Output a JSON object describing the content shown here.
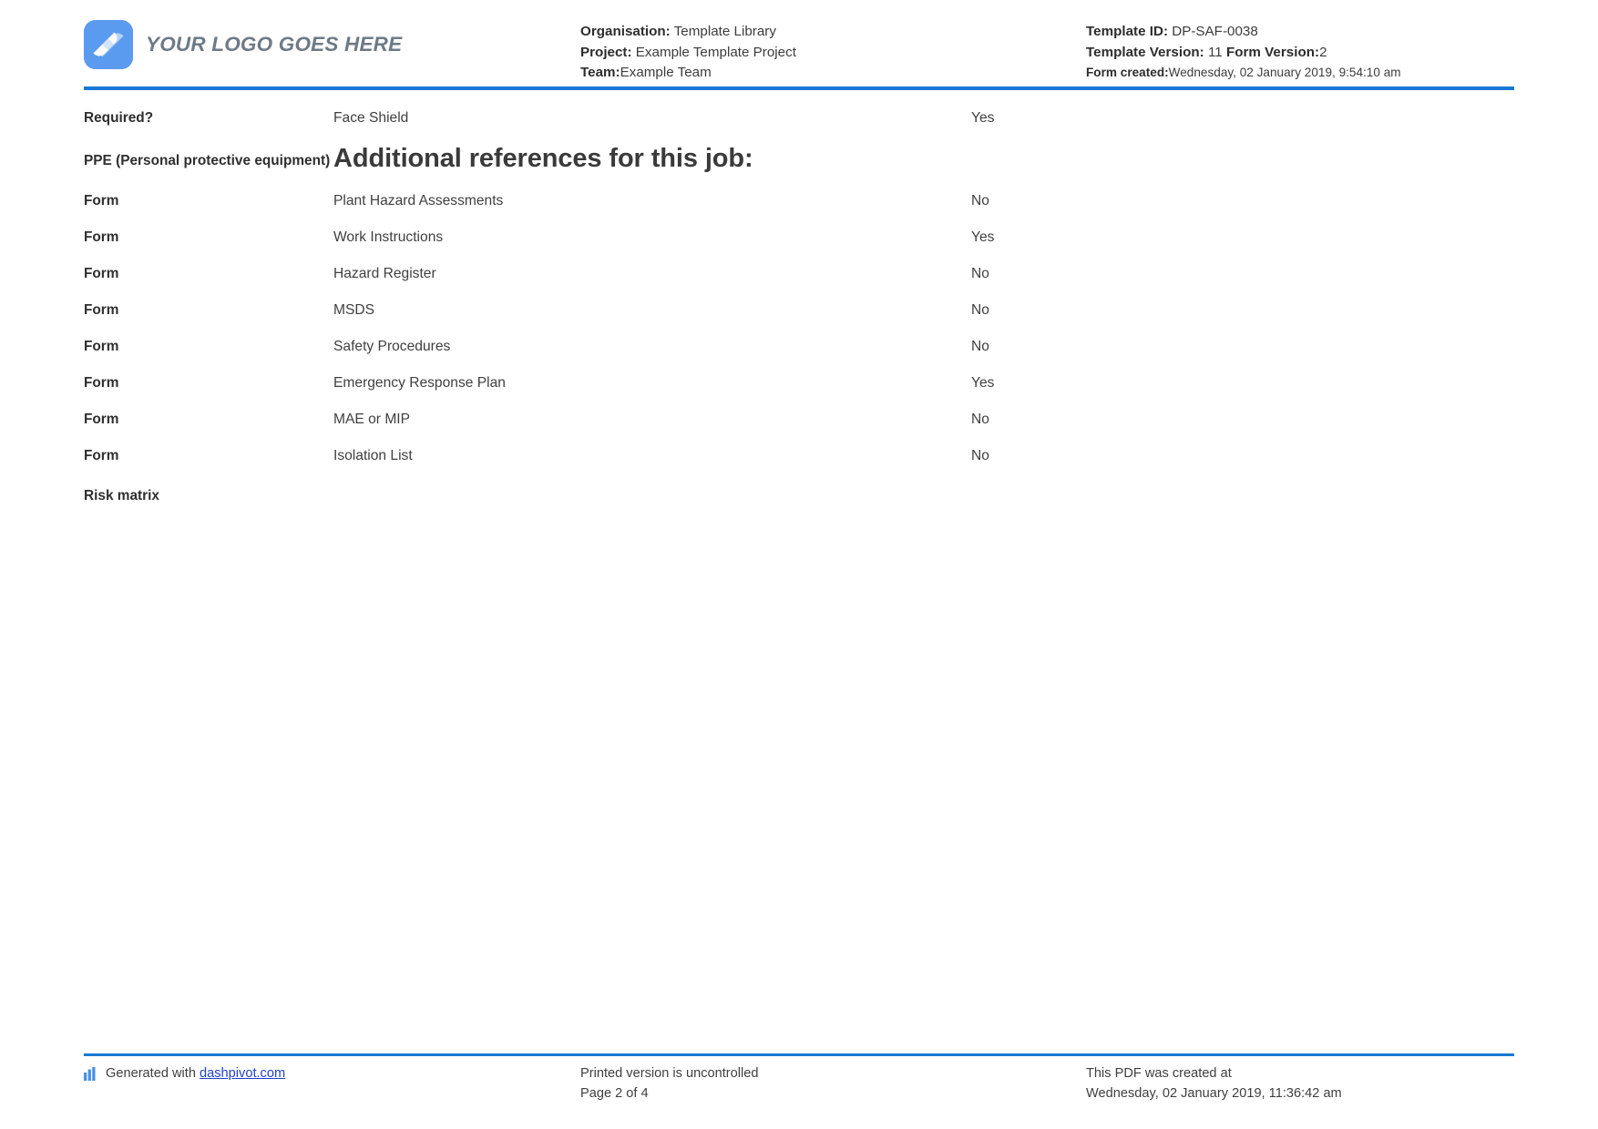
{
  "header": {
    "logo": {
      "icon": "dashpivot-logo-icon",
      "text": "YOUR LOGO GOES HERE",
      "color": "#5b9bef"
    },
    "mid": {
      "organisation_label": "Organisation:",
      "organisation_value": "Template Library",
      "project_label": "Project:",
      "project_value": "Example Template Project",
      "team_label": "Team:",
      "team_value": "Example Team"
    },
    "right": {
      "template_id_label": "Template ID:",
      "template_id_value": "DP-SAF-0038",
      "template_version_label": "Template Version:",
      "template_version_value": "11",
      "form_version_label": "Form Version:",
      "form_version_value": "2",
      "form_created_label": "Form created:",
      "form_created_value": "Wednesday, 02 January 2019, 9:54:10 am"
    },
    "rule_color": "#1779d4"
  },
  "body": {
    "required_row": {
      "label": "Required?",
      "value": "Face Shield",
      "answer": "Yes"
    },
    "ppe_row": {
      "label": "PPE (Personal protective equipment)",
      "section_title": "Additional references for this job:",
      "answer": ""
    },
    "form_rows": [
      {
        "label": "Form",
        "value": "Plant Hazard Assessments",
        "answer": "No"
      },
      {
        "label": "Form",
        "value": "Work Instructions",
        "answer": "Yes"
      },
      {
        "label": "Form",
        "value": "Hazard Register",
        "answer": "No"
      },
      {
        "label": "Form",
        "value": "MSDS",
        "answer": "No"
      },
      {
        "label": "Form",
        "value": "Safety Procedures",
        "answer": "No"
      },
      {
        "label": "Form",
        "value": "Emergency Response Plan",
        "answer": "Yes"
      },
      {
        "label": "Form",
        "value": "MAE or MIP",
        "answer": "No"
      },
      {
        "label": "Form",
        "value": "Isolation List",
        "answer": "No"
      }
    ],
    "risk_row": {
      "label": "Risk matrix",
      "value": "",
      "answer": ""
    }
  },
  "footer": {
    "generated_prefix": "Generated with ",
    "generated_link": "dashpivot.com",
    "printed_notice": "Printed version is uncontrolled",
    "page_number": "Page 2 of 4",
    "pdf_created_label": "This PDF was created at",
    "pdf_created_value": "Wednesday, 02 January 2019, 11:36:42 am",
    "icon": "bar-chart-icon",
    "rule_color": "#1779d4"
  }
}
